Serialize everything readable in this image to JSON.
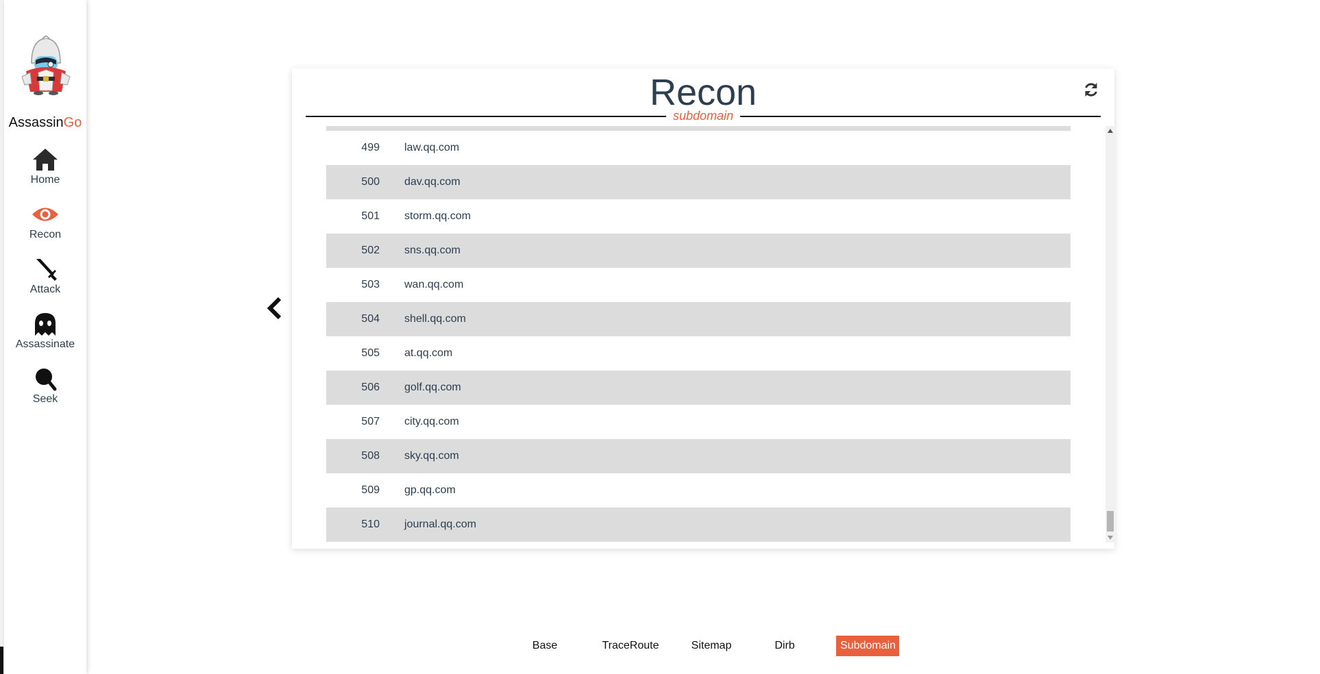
{
  "brand": {
    "name_prefix": "Assassin",
    "name_suffix": "Go",
    "accent": "#e8603c"
  },
  "sidebar": {
    "items": [
      {
        "label": "Home",
        "icon": "home-icon"
      },
      {
        "label": "Recon",
        "icon": "eye-icon",
        "active": true
      },
      {
        "label": "Attack",
        "icon": "sword-icon"
      },
      {
        "label": "Assassinate",
        "icon": "ghost-icon"
      },
      {
        "label": "Seek",
        "icon": "search-icon"
      }
    ]
  },
  "panel": {
    "title": "Recon",
    "subtitle": "subdomain",
    "refresh_icon": "refresh-icon"
  },
  "results": {
    "rows": [
      {
        "num": "499",
        "domain": "law.qq.com"
      },
      {
        "num": "500",
        "domain": "dav.qq.com"
      },
      {
        "num": "501",
        "domain": "storm.qq.com"
      },
      {
        "num": "502",
        "domain": "sns.qq.com"
      },
      {
        "num": "503",
        "domain": "wan.qq.com"
      },
      {
        "num": "504",
        "domain": "shell.qq.com"
      },
      {
        "num": "505",
        "domain": "at.qq.com"
      },
      {
        "num": "506",
        "domain": "golf.qq.com"
      },
      {
        "num": "507",
        "domain": "city.qq.com"
      },
      {
        "num": "508",
        "domain": "sky.qq.com"
      },
      {
        "num": "509",
        "domain": "gp.qq.com"
      },
      {
        "num": "510",
        "domain": "journal.qq.com"
      }
    ]
  },
  "tabs": [
    {
      "label": "Base"
    },
    {
      "label": "TraceRoute"
    },
    {
      "label": "Sitemap"
    },
    {
      "label": "Dirb"
    },
    {
      "label": "Subdomain",
      "active": true
    }
  ]
}
